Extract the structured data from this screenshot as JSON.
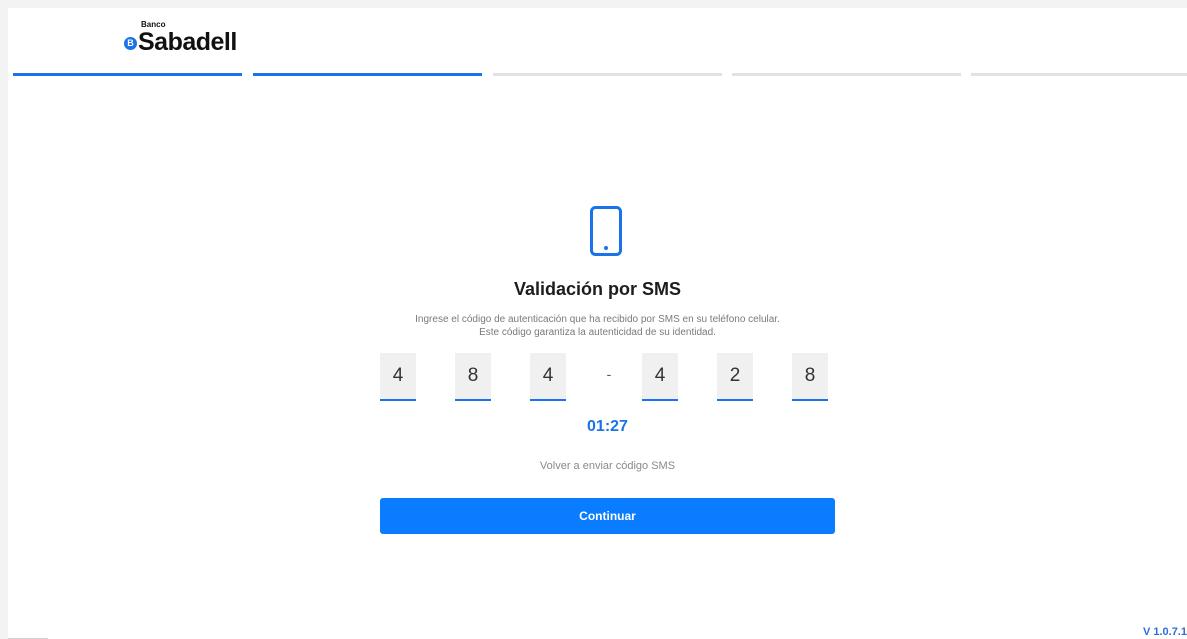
{
  "brand": {
    "small_text": "Banco",
    "name": "Sabadell",
    "badge_letter": "B",
    "color": "#1a73e8"
  },
  "progress": {
    "total_steps": 5,
    "active_steps": 2
  },
  "main": {
    "icon": "smartphone-icon",
    "title": "Validación por SMS",
    "description_line1": "Ingrese el código de autenticación que ha recibido por SMS en su teléfono celular.",
    "description_line2": "Este código garantiza la autenticidad de su identidad.",
    "code_digits": [
      "4",
      "8",
      "4",
      "4",
      "2",
      "8"
    ],
    "code_separator": "-",
    "timer": "01:27",
    "resend_label": "Volver a enviar código SMS",
    "continue_label": "Continuar"
  },
  "footer": {
    "version": "V 1.0.7.1"
  },
  "colors": {
    "accent": "#1a73e8",
    "button": "#0a7cff"
  }
}
